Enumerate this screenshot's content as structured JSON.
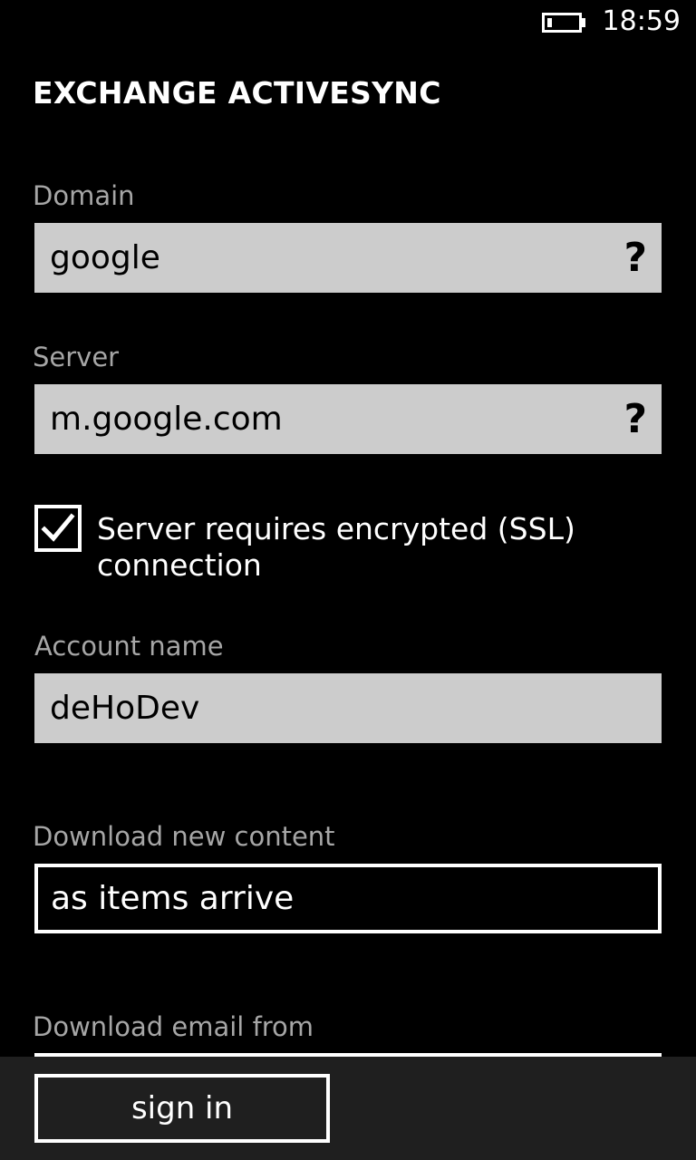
{
  "status_bar": {
    "time": "18:59",
    "battery_level": 0.15
  },
  "page": {
    "title": "EXCHANGE ACTIVESYNC"
  },
  "domain": {
    "label": "Domain",
    "value": "google",
    "help": "?"
  },
  "server": {
    "label": "Server",
    "value": "m.google.com",
    "help": "?"
  },
  "ssl": {
    "label": "Server requires encrypted (SSL) connection",
    "checked": true
  },
  "account_name": {
    "label": "Account name",
    "value": "deHoDev"
  },
  "download_new_content": {
    "label": "Download new content",
    "value": "as items arrive"
  },
  "download_email_from": {
    "label": "Download email from"
  },
  "app_bar": {
    "sign_in_label": "sign in"
  },
  "icons": {
    "battery": "battery-icon",
    "help": "question-mark-icon",
    "check": "checkmark-icon"
  },
  "colors": {
    "background": "#000000",
    "input_background": "#cccccc",
    "label_text": "#a6a6a6",
    "app_bar": "#1f1f1f",
    "foreground": "#ffffff"
  }
}
